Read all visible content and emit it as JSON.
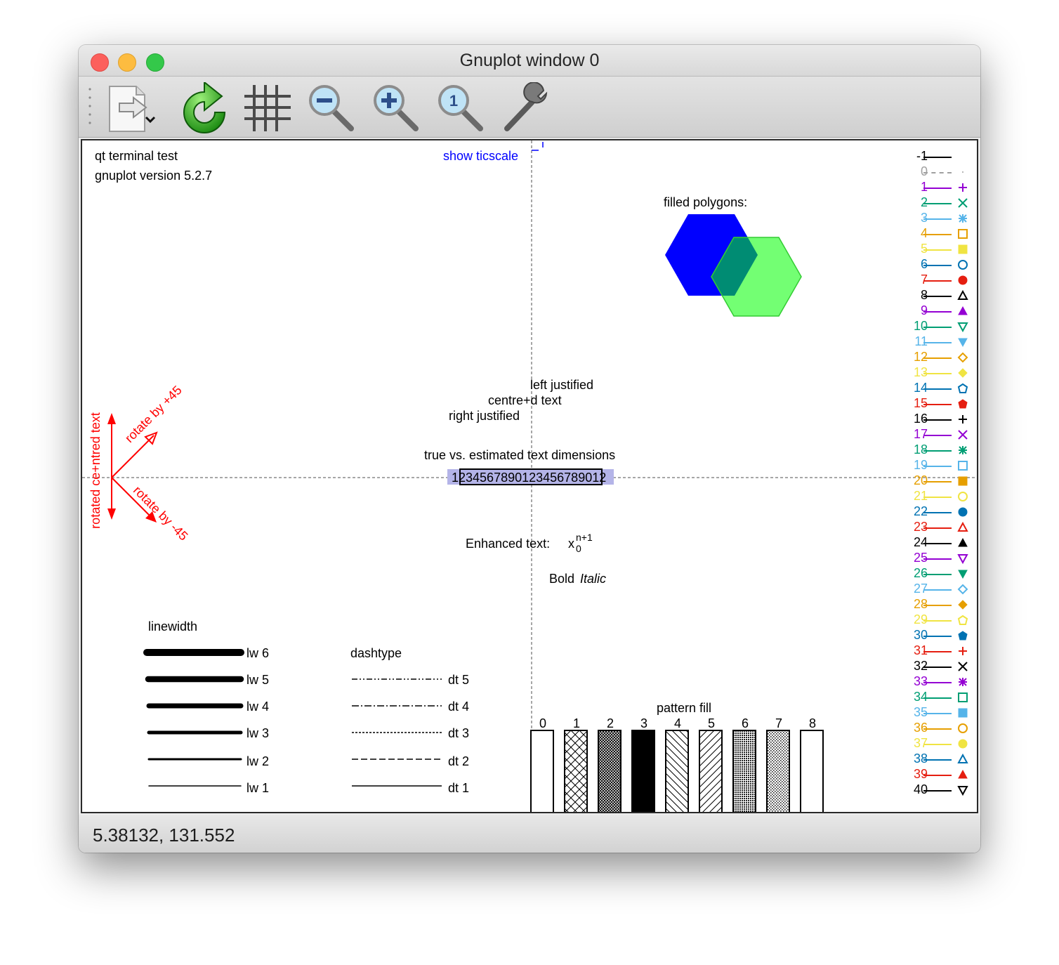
{
  "window": {
    "title": "Gnuplot window 0"
  },
  "toolbar": {
    "icons": [
      "export-icon",
      "replot-icon",
      "grid-icon",
      "zoom-out-icon",
      "zoom-in-icon",
      "zoom-reset-icon",
      "settings-icon"
    ]
  },
  "plot": {
    "terminal_text": "qt  terminal test",
    "version_text": "gnuplot version 5.2.7",
    "ticscale_label": "show ticscale",
    "filled_polygons_label": "filled polygons:",
    "left_justified": "left justified",
    "centred_text": "centre+d text",
    "right_justified": "right justified",
    "text_dims_label": "true vs. estimated text dimensions",
    "text_dims_sample": "1234567890123456789012",
    "enhanced_label": "Enhanced text:",
    "enhanced_base": "x",
    "enhanced_sub": "0",
    "enhanced_sup": "n+1",
    "bold_label": "Bold",
    "italic_label": "Italic",
    "rotated_centred": "rotated ce+ntred text",
    "rotate_plus": "rotate by +45",
    "rotate_minus": "rotate by -45",
    "linewidth_label": "linewidth",
    "linewidths": [
      "lw 6",
      "lw 5",
      "lw 4",
      "lw 3",
      "lw 2",
      "lw 1"
    ],
    "dashtype_label": "dashtype",
    "dashtypes": [
      "dt 5",
      "dt 4",
      "dt 3",
      "dt 2",
      "dt 1"
    ],
    "pattern_label": "pattern fill",
    "patterns": [
      "0",
      "1",
      "2",
      "3",
      "4",
      "5",
      "6",
      "7",
      "8"
    ]
  },
  "legend": [
    {
      "n": "-1",
      "color": "#000000",
      "sym": "none"
    },
    {
      "n": "0",
      "color": "#a0a0a0",
      "sym": "dot"
    },
    {
      "n": "1",
      "color": "#9400d3",
      "sym": "plus"
    },
    {
      "n": "2",
      "color": "#009e73",
      "sym": "cross"
    },
    {
      "n": "3",
      "color": "#56b4e9",
      "sym": "star"
    },
    {
      "n": "4",
      "color": "#e69f00",
      "sym": "box"
    },
    {
      "n": "5",
      "color": "#f0e442",
      "sym": "fbox"
    },
    {
      "n": "6",
      "color": "#0072b2",
      "sym": "circle"
    },
    {
      "n": "7",
      "color": "#e51e10",
      "sym": "fcircle"
    },
    {
      "n": "8",
      "color": "#000000",
      "sym": "tri"
    },
    {
      "n": "9",
      "color": "#9400d3",
      "sym": "ftri"
    },
    {
      "n": "10",
      "color": "#009e73",
      "sym": "itri"
    },
    {
      "n": "11",
      "color": "#56b4e9",
      "sym": "fitri"
    },
    {
      "n": "12",
      "color": "#e69f00",
      "sym": "diamond"
    },
    {
      "n": "13",
      "color": "#f0e442",
      "sym": "fdiamond"
    },
    {
      "n": "14",
      "color": "#0072b2",
      "sym": "pent"
    },
    {
      "n": "15",
      "color": "#e51e10",
      "sym": "fpent"
    },
    {
      "n": "16",
      "color": "#000000",
      "sym": "plus"
    },
    {
      "n": "17",
      "color": "#9400d3",
      "sym": "cross"
    },
    {
      "n": "18",
      "color": "#009e73",
      "sym": "star"
    },
    {
      "n": "19",
      "color": "#56b4e9",
      "sym": "box"
    },
    {
      "n": "20",
      "color": "#e69f00",
      "sym": "fbox"
    },
    {
      "n": "21",
      "color": "#f0e442",
      "sym": "circle"
    },
    {
      "n": "22",
      "color": "#0072b2",
      "sym": "fcircle"
    },
    {
      "n": "23",
      "color": "#e51e10",
      "sym": "tri"
    },
    {
      "n": "24",
      "color": "#000000",
      "sym": "ftri"
    },
    {
      "n": "25",
      "color": "#9400d3",
      "sym": "itri"
    },
    {
      "n": "26",
      "color": "#009e73",
      "sym": "fitri"
    },
    {
      "n": "27",
      "color": "#56b4e9",
      "sym": "diamond"
    },
    {
      "n": "28",
      "color": "#e69f00",
      "sym": "fdiamond"
    },
    {
      "n": "29",
      "color": "#f0e442",
      "sym": "pent"
    },
    {
      "n": "30",
      "color": "#0072b2",
      "sym": "fpent"
    },
    {
      "n": "31",
      "color": "#e51e10",
      "sym": "plus"
    },
    {
      "n": "32",
      "color": "#000000",
      "sym": "cross"
    },
    {
      "n": "33",
      "color": "#9400d3",
      "sym": "star"
    },
    {
      "n": "34",
      "color": "#009e73",
      "sym": "box"
    },
    {
      "n": "35",
      "color": "#56b4e9",
      "sym": "fbox"
    },
    {
      "n": "36",
      "color": "#e69f00",
      "sym": "circle"
    },
    {
      "n": "37",
      "color": "#f0e442",
      "sym": "fcircle"
    },
    {
      "n": "38",
      "color": "#0072b2",
      "sym": "tri"
    },
    {
      "n": "39",
      "color": "#e51e10",
      "sym": "ftri"
    },
    {
      "n": "40",
      "color": "#000000",
      "sym": "itri"
    }
  ],
  "statusbar": {
    "coords": "5.38132,  131.552"
  }
}
